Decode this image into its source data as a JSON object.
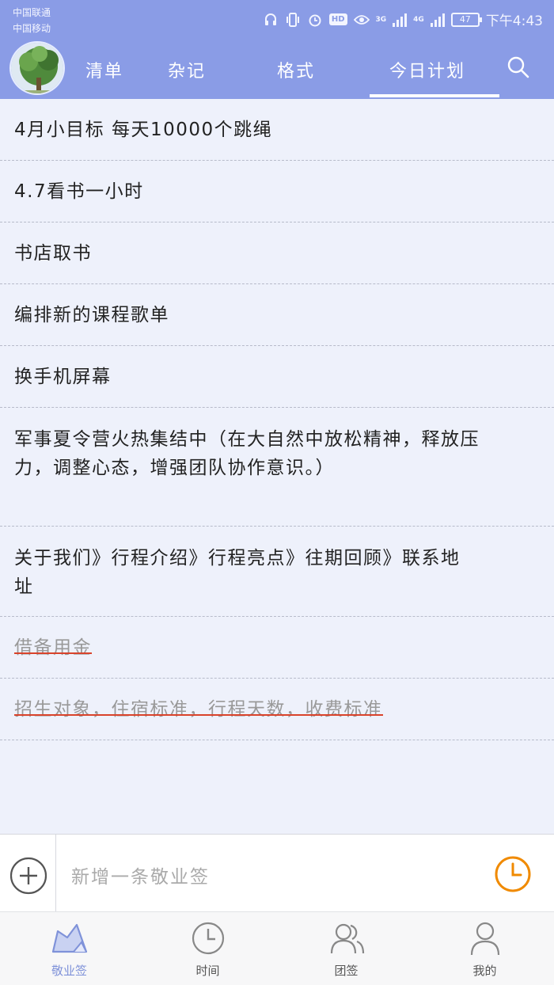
{
  "statusbar": {
    "carrier1": "中国联通",
    "carrier2": "中国移动",
    "network1": "3G",
    "network2": "4G",
    "battery": "47",
    "time": "下午4:43"
  },
  "tabs": [
    {
      "label": "清单"
    },
    {
      "label": "杂记"
    },
    {
      "label": "格式"
    },
    {
      "label": "今日计划"
    }
  ],
  "items": [
    {
      "text": "4月小目标 每天10000个跳绳"
    },
    {
      "text": "4.7看书一小时"
    },
    {
      "text": "书店取书"
    },
    {
      "text": "编排新的课程歌单"
    },
    {
      "text": "换手机屏幕"
    },
    {
      "text": "军事夏令营火热集结中（在大自然中放松精神，释放压力，调整心态，增强团队协作意识。）"
    },
    {
      "text": "关于我们》行程介绍》行程亮点》往期回顾》联系地址"
    },
    {
      "text": "借备用金",
      "done": true
    },
    {
      "text": "招生对象，住宿标准，行程天数，收费标准",
      "done": true
    }
  ],
  "input": {
    "placeholder": "新增一条敬业签"
  },
  "nav": [
    {
      "label": "敬业签",
      "icon": "cloud-note-icon",
      "active": true
    },
    {
      "label": "时间",
      "icon": "clock-icon"
    },
    {
      "label": "团签",
      "icon": "team-icon"
    },
    {
      "label": "我的",
      "icon": "person-icon"
    }
  ],
  "colors": {
    "header": "#8a9ce6",
    "accent": "#f08a00",
    "strike": "#d9432b",
    "background": "#eef1fb"
  }
}
